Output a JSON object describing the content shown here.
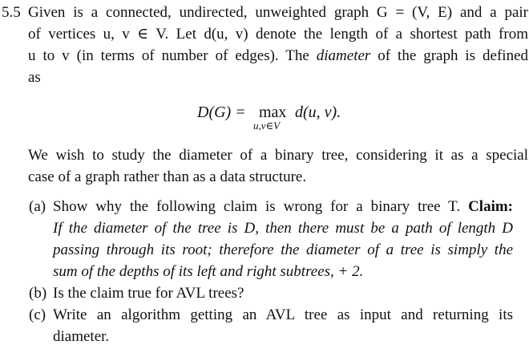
{
  "problem": {
    "number": "5.5",
    "intro_lines": [
      "Given is a connected, undirected, unweighted graph G = (V, E) and a pair",
      "of vertices u, v ∈ V. Let d(u, v) denote the length of a shortest path from",
      "u to v (in terms of number of edges). The diameter of the graph is defined",
      "as"
    ],
    "equation": {
      "lhs": "D(G) =",
      "operator": "max",
      "subscript": "u,v∈V",
      "rhs": "d(u, v)."
    },
    "study_lines": [
      "We wish to study the diameter of a binary tree, considering it as a special",
      "case of a graph rather than as a data structure."
    ]
  },
  "parts": [
    {
      "label": "(a)",
      "lines": [
        "Show why the following claim is wrong for a binary tree T. Claim:",
        "If the diameter of the tree is D, then there must be a path of length D",
        "passing through its root; therefore the diameter of a tree is simply the",
        "sum of the depths of its left and right subtrees, + 2."
      ]
    },
    {
      "label": "(b)",
      "lines": [
        "Is the claim true for AVL trees?"
      ]
    },
    {
      "label": "(c)",
      "lines": [
        "Write an algorithm getting an AVL tree as input and returning its",
        "diameter."
      ]
    }
  ]
}
